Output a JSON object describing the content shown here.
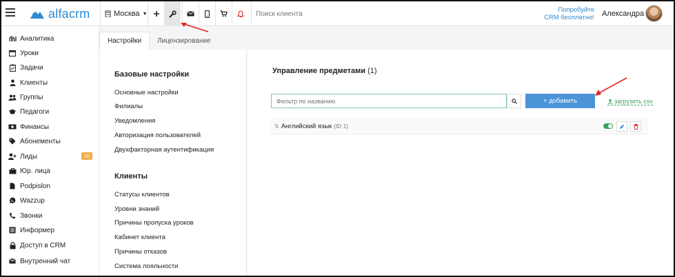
{
  "app": {
    "logo_text": "alfacrm"
  },
  "topbar": {
    "city": "Москва",
    "search_placeholder": "Поиск клиента",
    "promo_line1": "Попробуйте",
    "promo_line2": "CRM бесплатно!",
    "user_name": "Александра",
    "icons": [
      "plus-icon",
      "wrench-icon",
      "mail-icon",
      "phone-icon",
      "cart-icon",
      "bell-icon"
    ]
  },
  "sidebar": {
    "items": [
      {
        "label": "Аналитика",
        "icon": "analytics-icon"
      },
      {
        "label": "Уроки",
        "icon": "calendar-icon"
      },
      {
        "label": "Задачи",
        "icon": "clipboard-icon"
      },
      {
        "label": "Клиенты",
        "icon": "user-icon"
      },
      {
        "label": "Группы",
        "icon": "users-icon"
      },
      {
        "label": "Педагоги",
        "icon": "graduation-cap-icon"
      },
      {
        "label": "Финансы",
        "icon": "money-icon"
      },
      {
        "label": "Абонементы",
        "icon": "tag-icon"
      },
      {
        "label": "Лиды",
        "icon": "user-plus-icon",
        "badge": "20"
      },
      {
        "label": "Юр. лица",
        "icon": "briefcase-icon"
      },
      {
        "label": "Podpislon",
        "icon": "file-icon"
      },
      {
        "label": "Wazzup",
        "icon": "whatsapp-icon"
      },
      {
        "label": "Звонки",
        "icon": "phone-icon"
      },
      {
        "label": "Информер",
        "icon": "list-icon"
      },
      {
        "label": "Доступ в CRM",
        "icon": "lock-icon"
      },
      {
        "label": "Внутренний чат",
        "icon": "envelope-icon"
      }
    ]
  },
  "tabs": [
    {
      "label": "Настройки",
      "active": true
    },
    {
      "label": "Лицензирование",
      "active": false
    }
  ],
  "settings": {
    "basic_title": "Базовые настройки",
    "basic_links": [
      "Основные настройки",
      "Филиалы",
      "Уведомления",
      "Авторизация пользователей",
      "Двухфакторная аутентификация"
    ],
    "clients_title": "Клиенты",
    "clients_links": [
      "Статусы клиентов",
      "Уровни знаний",
      "Причины пропуска уроков",
      "Кабинет клиента",
      "Причины отказов",
      "Система лояльности"
    ]
  },
  "main": {
    "title": "Управление предметами",
    "count": "(1)",
    "filter_placeholder": "Фильтр по названию",
    "add_button": "+ добавить",
    "csv_link": "загрузить csv",
    "rows": [
      {
        "name": "Английский язык",
        "id": "(ID 1)",
        "enabled": true
      }
    ]
  },
  "colors": {
    "accent": "#4b94d8",
    "brand": "#2c8bd3",
    "success": "#3aa35f",
    "badge": "#f0ad4e",
    "annotation": "#e02424"
  }
}
